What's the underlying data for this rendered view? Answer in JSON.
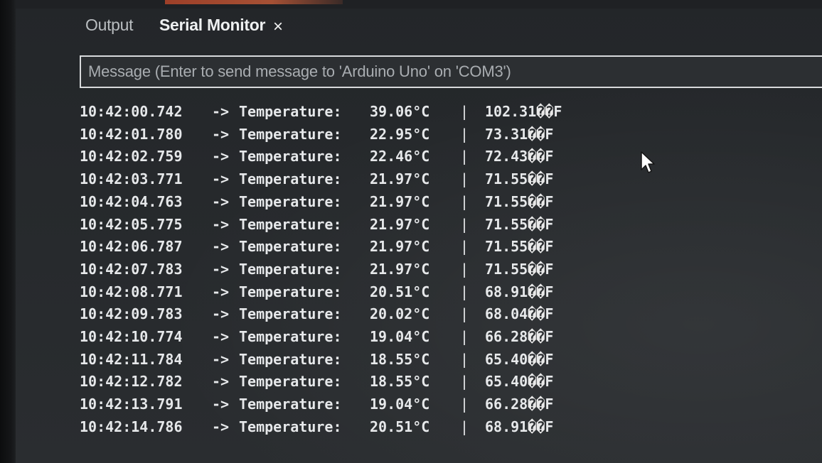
{
  "tabs": {
    "output_label": "Output",
    "serial_label": "Serial Monitor",
    "close_symbol": "×"
  },
  "message": {
    "placeholder": "Message (Enter to send message to 'Arduino Uno' on 'COM3')"
  },
  "log": {
    "arrow": "->",
    "label": "Temperature:",
    "separator": "|",
    "invalid_glyphs": "��",
    "fahrenheit_unit": "F",
    "rows": [
      {
        "time": "10:42:00.742",
        "celsius": "39.06°C",
        "fahrenheit": "102.31"
      },
      {
        "time": "10:42:01.780",
        "celsius": "22.95°C",
        "fahrenheit": "73.31"
      },
      {
        "time": "10:42:02.759",
        "celsius": "22.46°C",
        "fahrenheit": "72.43"
      },
      {
        "time": "10:42:03.771",
        "celsius": "21.97°C",
        "fahrenheit": "71.55"
      },
      {
        "time": "10:42:04.763",
        "celsius": "21.97°C",
        "fahrenheit": "71.55"
      },
      {
        "time": "10:42:05.775",
        "celsius": "21.97°C",
        "fahrenheit": "71.55"
      },
      {
        "time": "10:42:06.787",
        "celsius": "21.97°C",
        "fahrenheit": "71.55"
      },
      {
        "time": "10:42:07.783",
        "celsius": "21.97°C",
        "fahrenheit": "71.55"
      },
      {
        "time": "10:42:08.771",
        "celsius": "20.51°C",
        "fahrenheit": "68.91"
      },
      {
        "time": "10:42:09.783",
        "celsius": "20.02°C",
        "fahrenheit": "68.04"
      },
      {
        "time": "10:42:10.774",
        "celsius": "19.04°C",
        "fahrenheit": "66.28"
      },
      {
        "time": "10:42:11.784",
        "celsius": "18.55°C",
        "fahrenheit": "65.40"
      },
      {
        "time": "10:42:12.782",
        "celsius": "18.55°C",
        "fahrenheit": "65.40"
      },
      {
        "time": "10:42:13.791",
        "celsius": "19.04°C",
        "fahrenheit": "66.28"
      },
      {
        "time": "10:42:14.786",
        "celsius": "20.51°C",
        "fahrenheit": "68.91"
      }
    ]
  },
  "colors": {
    "background": "#26292c",
    "text": "#e6e8ea",
    "active_tab_marker": "#d2603a"
  },
  "icons": {
    "close": "close-icon",
    "cursor": "mouse-pointer-icon"
  }
}
